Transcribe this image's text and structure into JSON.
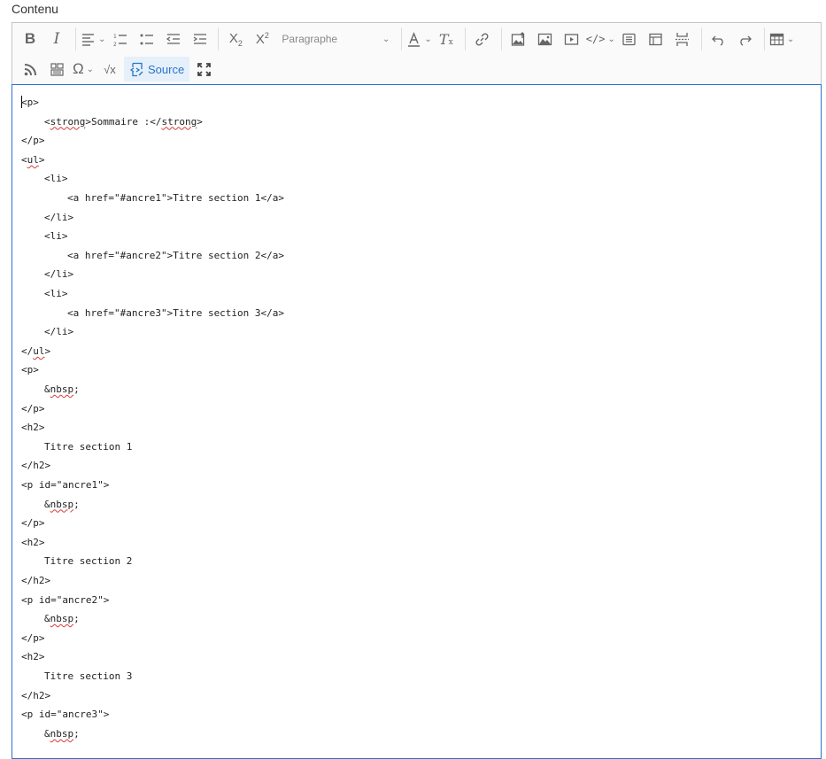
{
  "field_label": "Contenu",
  "toolbar": {
    "paragraph_select": "Paragraphe",
    "source_label": "Source",
    "buttons": [
      "bold-icon",
      "italic-icon",
      "align-icon",
      "numbered-list-icon",
      "bulleted-list-icon",
      "outdent-icon",
      "indent-icon",
      "subscript-icon",
      "superscript-icon",
      "font-color-icon",
      "remove-format-icon",
      "link-icon",
      "upload-image-icon",
      "image-icon",
      "media-icon",
      "code-block-icon",
      "html-embed-icon",
      "layout-icon",
      "page-break-icon",
      "undo-icon",
      "redo-icon",
      "table-icon",
      "rss-icon",
      "template-icon",
      "special-characters-icon",
      "math-icon",
      "source-icon",
      "fullscreen-icon"
    ]
  },
  "source": {
    "lines": [
      {
        "text": "<p>",
        "indent": 0
      },
      {
        "text": "<strong>Sommaire :</strong>",
        "indent": 1
      },
      {
        "text": "</p>",
        "indent": 0
      },
      {
        "text": "<ul>",
        "indent": 0
      },
      {
        "text": "<li>",
        "indent": 1
      },
      {
        "text": "<a href=\"#ancre1\">Titre section 1</a>",
        "indent": 2
      },
      {
        "text": "</li>",
        "indent": 1
      },
      {
        "text": "<li>",
        "indent": 1
      },
      {
        "text": "<a href=\"#ancre2\">Titre section 2</a>",
        "indent": 2
      },
      {
        "text": "</li>",
        "indent": 1
      },
      {
        "text": "<li>",
        "indent": 1
      },
      {
        "text": "<a href=\"#ancre3\">Titre section 3</a>",
        "indent": 2
      },
      {
        "text": "</li>",
        "indent": 1
      },
      {
        "text": "</ul>",
        "indent": 0
      },
      {
        "text": "<p>",
        "indent": 0
      },
      {
        "text": "&nbsp;",
        "indent": 1
      },
      {
        "text": "</p>",
        "indent": 0
      },
      {
        "text": "<h2>",
        "indent": 0
      },
      {
        "text": "Titre section 1",
        "indent": 1
      },
      {
        "text": "</h2>",
        "indent": 0
      },
      {
        "text": "<p id=\"ancre1\">",
        "indent": 0
      },
      {
        "text": "&nbsp;",
        "indent": 1
      },
      {
        "text": "</p>",
        "indent": 0
      },
      {
        "text": "<h2>",
        "indent": 0
      },
      {
        "text": "Titre section 2",
        "indent": 1
      },
      {
        "text": "</h2>",
        "indent": 0
      },
      {
        "text": "<p id=\"ancre2\">",
        "indent": 0
      },
      {
        "text": "&nbsp;",
        "indent": 1
      },
      {
        "text": "</p>",
        "indent": 0
      },
      {
        "text": "<h2>",
        "indent": 0
      },
      {
        "text": "Titre section 3",
        "indent": 1
      },
      {
        "text": "</h2>",
        "indent": 0
      },
      {
        "text": "<p id=\"ancre3\">",
        "indent": 0
      },
      {
        "text": "&nbsp;",
        "indent": 1
      }
    ]
  }
}
